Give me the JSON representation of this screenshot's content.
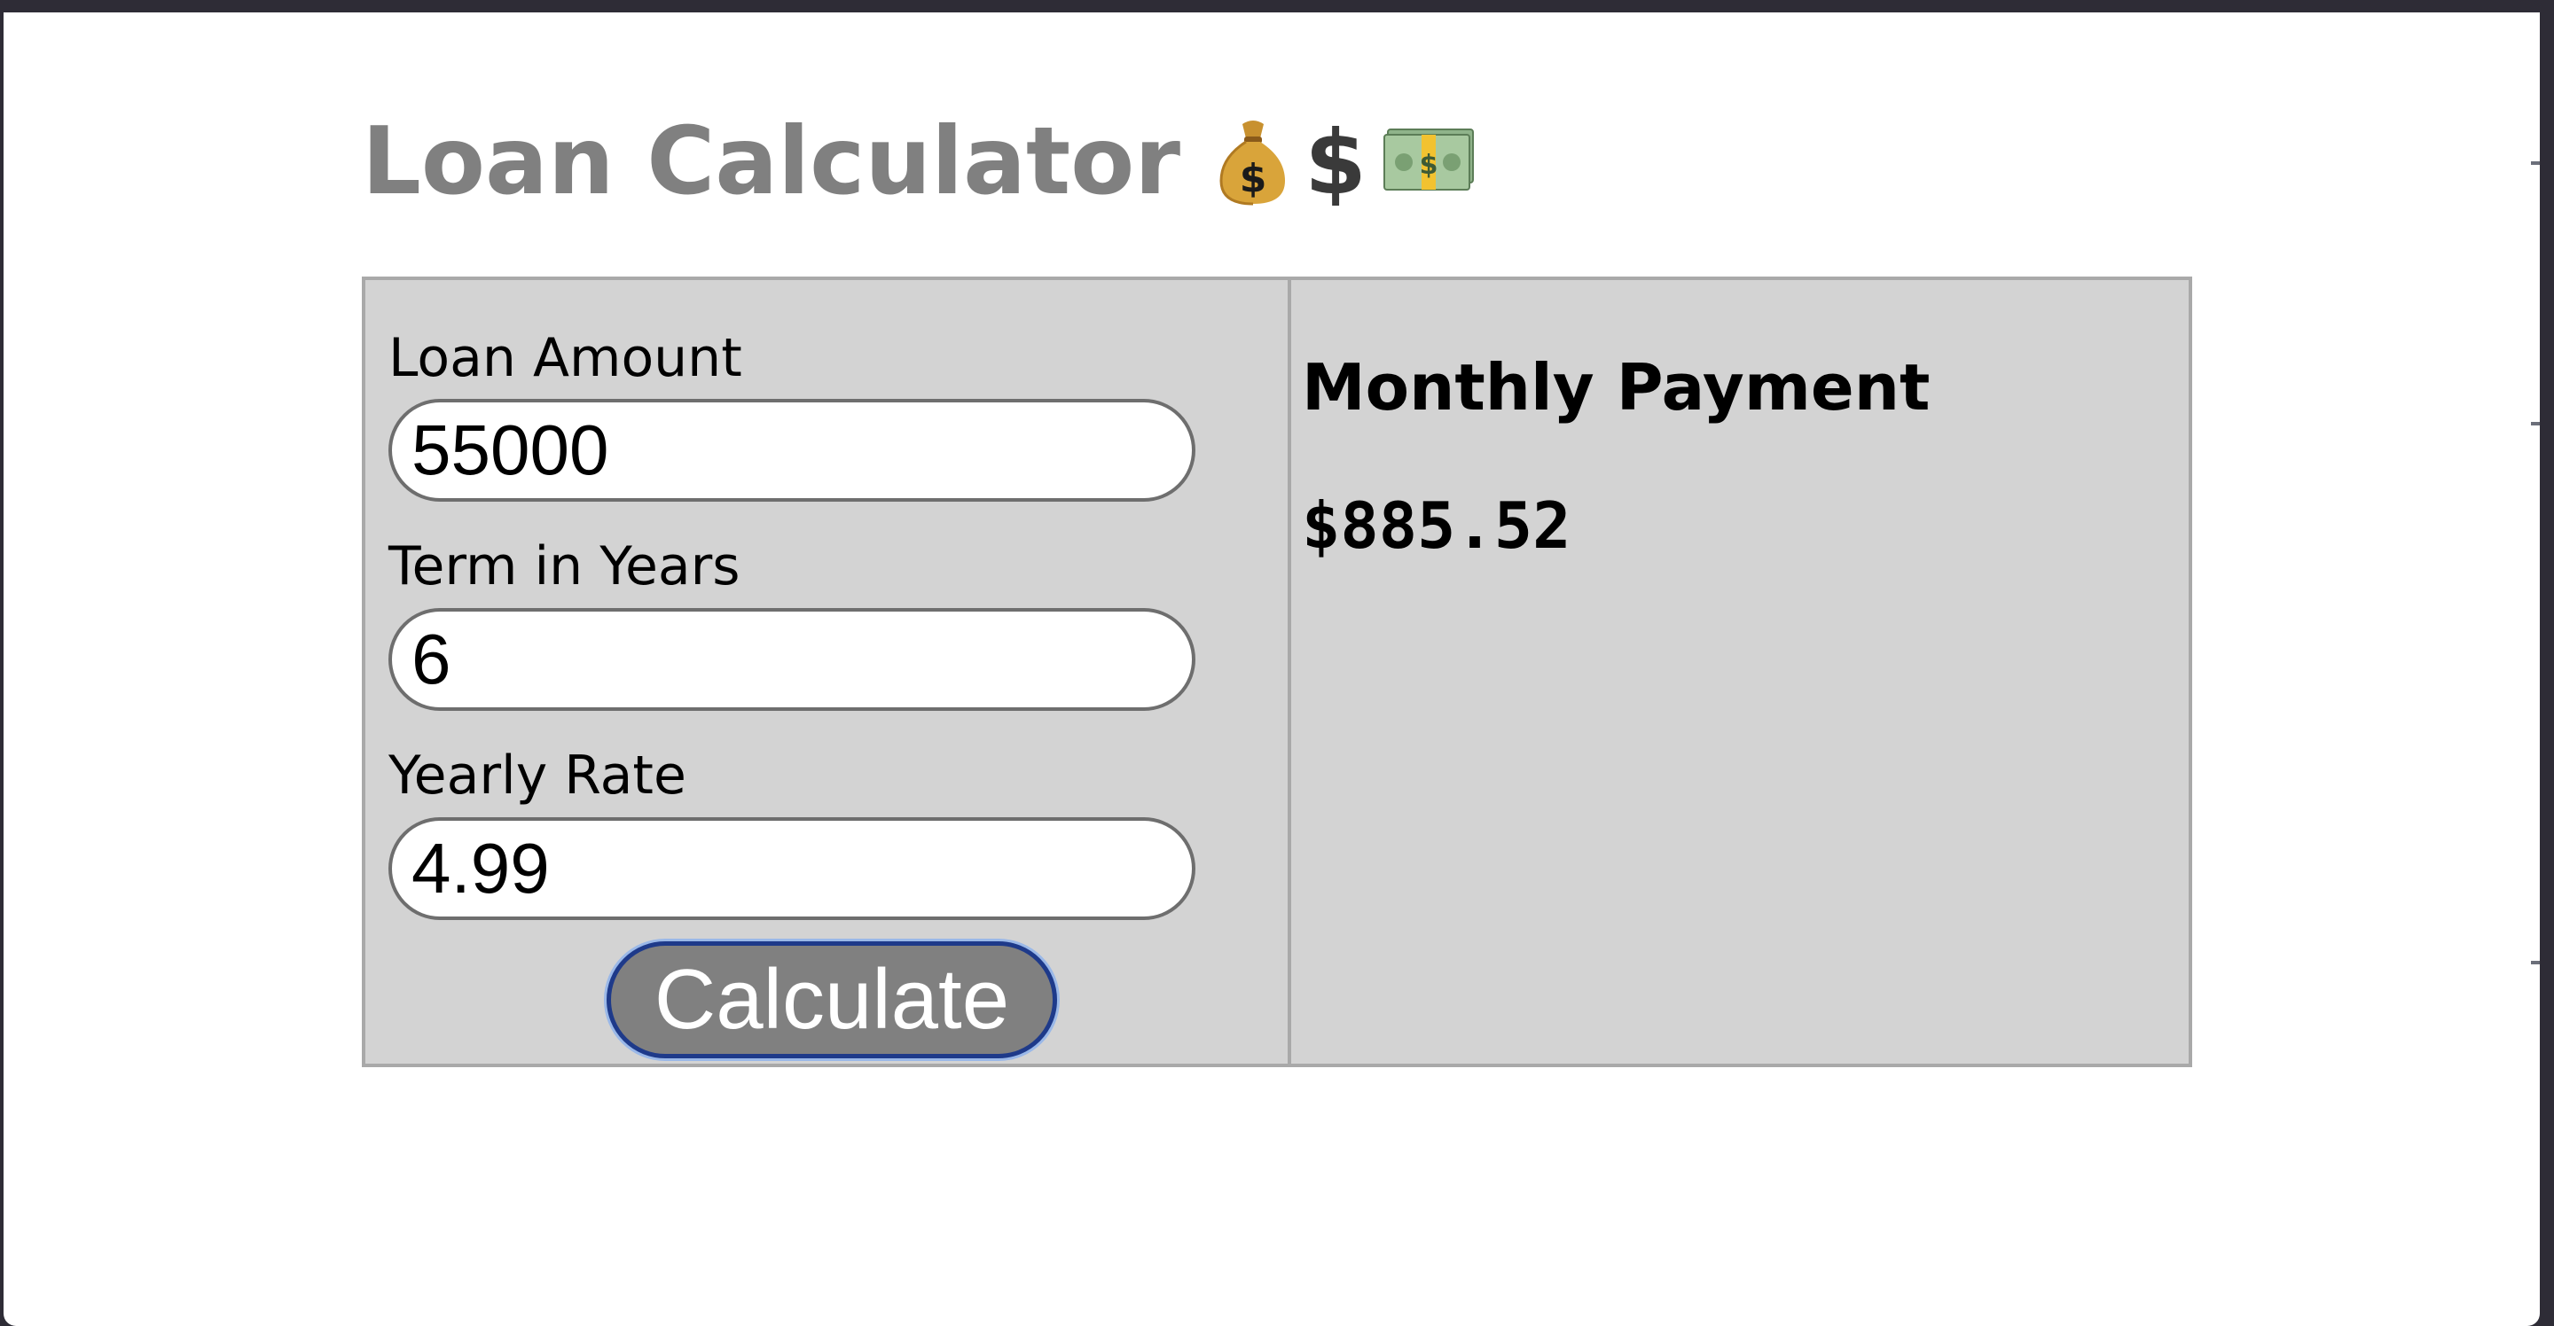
{
  "page": {
    "title": "Loan Calculator",
    "title_icons": [
      "money-bag-icon",
      "dollar-sign-icon",
      "dollar-banknote-icon"
    ]
  },
  "form": {
    "loan_amount": {
      "label": "Loan Amount",
      "value": "55000"
    },
    "term_years": {
      "label": "Term in Years",
      "value": "6"
    },
    "yearly_rate": {
      "label": "Yearly Rate",
      "value": "4.99"
    },
    "calculate_label": "Calculate"
  },
  "result": {
    "heading": "Monthly Payment",
    "value": "$885.52"
  },
  "colors": {
    "page_background": "#ffffff",
    "panel_background": "#d3d3d3",
    "panel_border": "#a9a9a9",
    "title_color": "#808080",
    "button_background": "#808080",
    "button_text": "#ffffff",
    "button_focus_ring": "#1e3a8a"
  }
}
